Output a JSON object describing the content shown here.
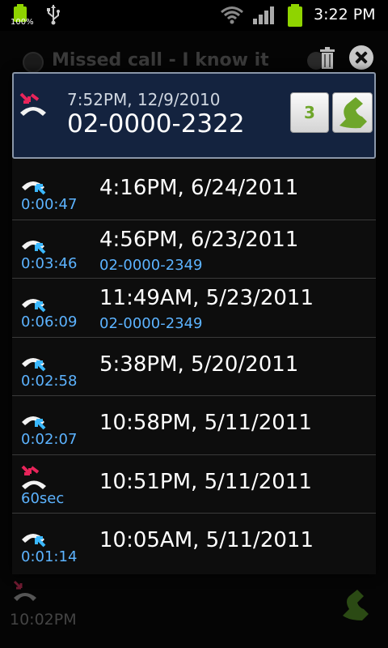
{
  "status_bar": {
    "battery_percent": "100%",
    "time": "3:22 PM",
    "icons": [
      "battery-icon",
      "usb-icon",
      "wifi-icon",
      "signal-icon",
      "battery-icon"
    ]
  },
  "background_app": {
    "title": "Missed call - I know it",
    "last_time": "10:02PM"
  },
  "popup": {
    "header": {
      "time": "7:52PM, 12/9/2010",
      "number": "02-0000-2322",
      "count": "3",
      "call_type": "missed"
    },
    "calls": [
      {
        "type": "incoming",
        "duration": "0:00:47",
        "datetime": "4:16PM, 6/24/2011",
        "number": ""
      },
      {
        "type": "incoming",
        "duration": "0:03:46",
        "datetime": "4:56PM, 6/23/2011",
        "number": "02-0000-2349"
      },
      {
        "type": "incoming",
        "duration": "0:06:09",
        "datetime": "11:49AM, 5/23/2011",
        "number": "02-0000-2349"
      },
      {
        "type": "incoming",
        "duration": "0:02:58",
        "datetime": "5:38PM, 5/20/2011",
        "number": ""
      },
      {
        "type": "incoming",
        "duration": "0:02:07",
        "datetime": "10:58PM, 5/11/2011",
        "number": ""
      },
      {
        "type": "missed",
        "duration": "60sec",
        "datetime": "10:51PM, 5/11/2011",
        "number": ""
      },
      {
        "type": "incoming",
        "duration": "0:01:14",
        "datetime": "10:05AM, 5/11/2011",
        "number": ""
      }
    ]
  },
  "colors": {
    "accent_blue": "#5cb3ff",
    "missed_red": "#e8245a",
    "call_green": "#6ea62a",
    "header_bg": "#14233f"
  }
}
